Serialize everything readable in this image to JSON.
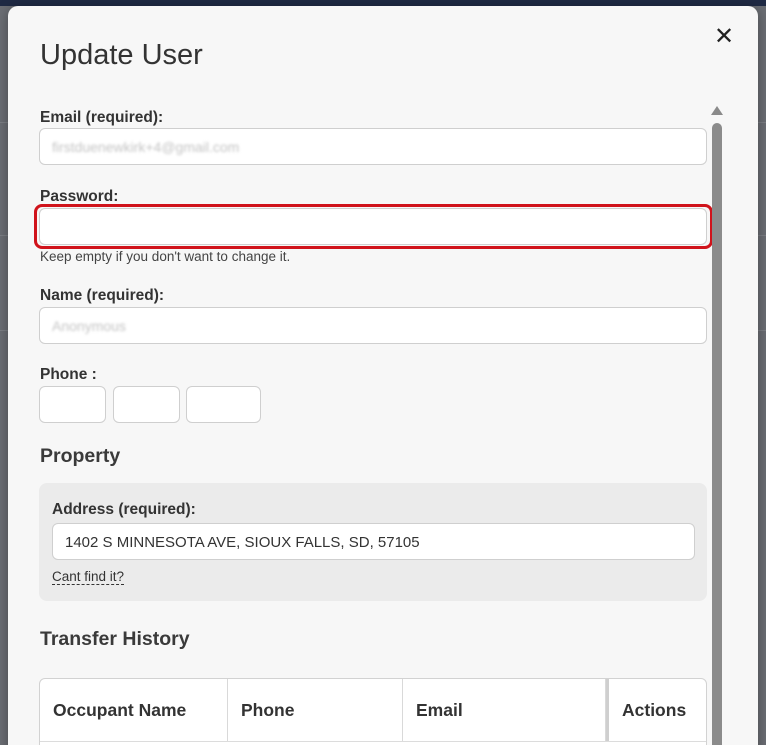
{
  "modal": {
    "title": "Update User",
    "close_glyph": "✕"
  },
  "form": {
    "email_label": "Email (required):",
    "email_value": "firstduenewkirk+4@gmail.com",
    "password_label": "Password:",
    "password_value": "",
    "password_hint": "Keep empty if you don't want to change it.",
    "name_label": "Name (required):",
    "name_value": "Anonymous",
    "phone_label": "Phone :",
    "phone_parts": [
      "",
      "",
      ""
    ]
  },
  "property": {
    "section_title": "Property",
    "address_label": "Address (required):",
    "address_value": "1402 S MINNESOTA AVE, SIOUX FALLS, SD, 57105",
    "cant_find_link": "Cant find it?"
  },
  "transfer_history": {
    "section_title": "Transfer History",
    "columns": [
      "Occupant Name",
      "Phone",
      "Email",
      "Actions"
    ]
  },
  "colors": {
    "highlight": "#d0131b",
    "modal_bg": "#f7f7f7"
  }
}
